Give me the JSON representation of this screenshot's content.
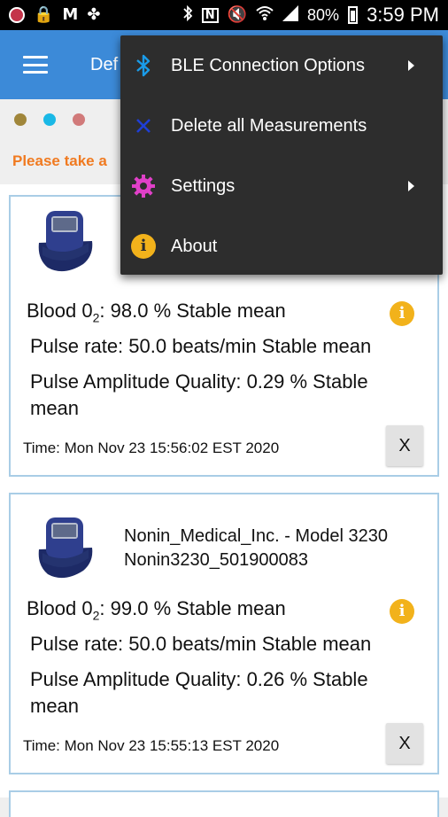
{
  "status_bar": {
    "battery": "80%",
    "time": "3:59 PM",
    "icons": [
      "notification-dot",
      "lock-icon",
      "gmail-icon",
      "pinwheel-icon",
      "bluetooth-icon",
      "nfc-icon",
      "mute-icon",
      "wifi-icon",
      "signal-icon",
      "battery-icon"
    ]
  },
  "app_bar": {
    "title": "Def",
    "menu_icon": "hamburger-icon"
  },
  "dots": [
    "#a0863a",
    "#1ab8e6",
    "#d17a7a"
  ],
  "notice": "Please take a",
  "overflow_menu": {
    "items": [
      {
        "label": "BLE Connection Options",
        "icon": "bluetooth-icon",
        "submenu": true
      },
      {
        "label": "Delete all Measurements",
        "icon": "close-icon",
        "submenu": false
      },
      {
        "label": "Settings",
        "icon": "gear-icon",
        "submenu": true
      },
      {
        "label": "About",
        "icon": "info-icon",
        "submenu": false
      }
    ]
  },
  "measurements": [
    {
      "device_line1": "",
      "device_line2": "",
      "blood_o2_prefix": "Blood 0",
      "blood_o2_sub": "2",
      "blood_o2_value": ": 98.0 % Stable mean",
      "pulse_rate": "Pulse rate: 50.0 beats/min Stable mean",
      "pulse_amp_line1": "Pulse Amplitude Quality: 0.29 % Stable",
      "pulse_amp_line2": "mean",
      "time": "Time: Mon Nov 23 15:56:02 EST 2020",
      "delete_label": "X"
    },
    {
      "device_line1": "Nonin_Medical_Inc. - Model 3230",
      "device_line2": "Nonin3230_501900083",
      "blood_o2_prefix": "Blood 0",
      "blood_o2_sub": "2",
      "blood_o2_value": ": 99.0 % Stable mean",
      "pulse_rate": "Pulse rate: 50.0 beats/min Stable mean",
      "pulse_amp_line1": "Pulse Amplitude Quality: 0.26 % Stable",
      "pulse_amp_line2": "mean",
      "time": "Time: Mon Nov 23 15:55:13 EST 2020",
      "delete_label": "X"
    }
  ],
  "colors": {
    "app_bar": "#3c8ad8",
    "accent_orange": "#f07a20",
    "info_yellow": "#f2b21b",
    "card_border": "#a9cde6",
    "menu_bg": "#2d2d2d",
    "bluetooth_blue": "#1a9be8",
    "delete_blue": "#1f3fd6",
    "settings_pink": "#e040c8"
  }
}
